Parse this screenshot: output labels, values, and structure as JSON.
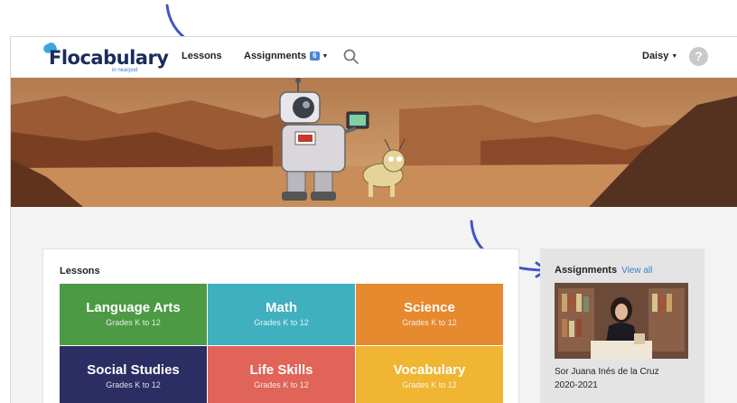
{
  "brand": {
    "name": "Flocabulary",
    "sub": "in nearpod"
  },
  "nav": {
    "lessons": "Lessons",
    "assignments": "Assignments",
    "assignments_badge": "6"
  },
  "user": {
    "name": "Daisy"
  },
  "help": "?",
  "lessons_section": {
    "title": "Lessons",
    "tiles": [
      {
        "title": "Language Arts",
        "grades": "Grades K to 12"
      },
      {
        "title": "Math",
        "grades": "Grades K to 12"
      },
      {
        "title": "Science",
        "grades": "Grades K to 12"
      },
      {
        "title": "Social Studies",
        "grades": "Grades K to 12"
      },
      {
        "title": "Life Skills",
        "grades": "Grades K to 12"
      },
      {
        "title": "Vocabulary",
        "grades": "Grades K to 12"
      }
    ]
  },
  "assignments_section": {
    "title": "Assignments",
    "view_all": "View all",
    "item_title": "Sor Juana Inés de la Cruz",
    "item_year": "2020-2021"
  },
  "colors": {
    "language_arts": "#4d9a45",
    "math": "#3fb0bf",
    "science": "#e6892f",
    "social_studies": "#2c2e63",
    "life_skills": "#e06458",
    "vocabulary": "#efb533",
    "arrow": "#4155c6",
    "link": "#3a7fd0"
  }
}
